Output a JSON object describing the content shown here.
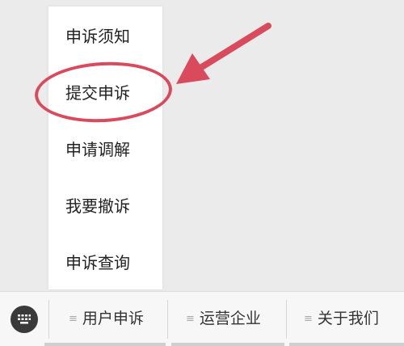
{
  "menu": {
    "items": [
      {
        "label": "申诉须知"
      },
      {
        "label": "提交申诉"
      },
      {
        "label": "申请调解"
      },
      {
        "label": "我要撤诉"
      },
      {
        "label": "申诉查询"
      }
    ],
    "highlighted_item": "提交申诉"
  },
  "bottom_bar": {
    "tabs": [
      {
        "label": "用户申诉",
        "icon": "hamburger-icon"
      },
      {
        "label": "运营企业",
        "icon": "hamburger-icon"
      },
      {
        "label": "关于我们",
        "icon": "hamburger-icon"
      }
    ],
    "keyboard_icon": "keyboard-icon"
  },
  "colors": {
    "highlight": "#d94a5c",
    "background": "#ebebeb",
    "menu_background": "#ffffff"
  }
}
